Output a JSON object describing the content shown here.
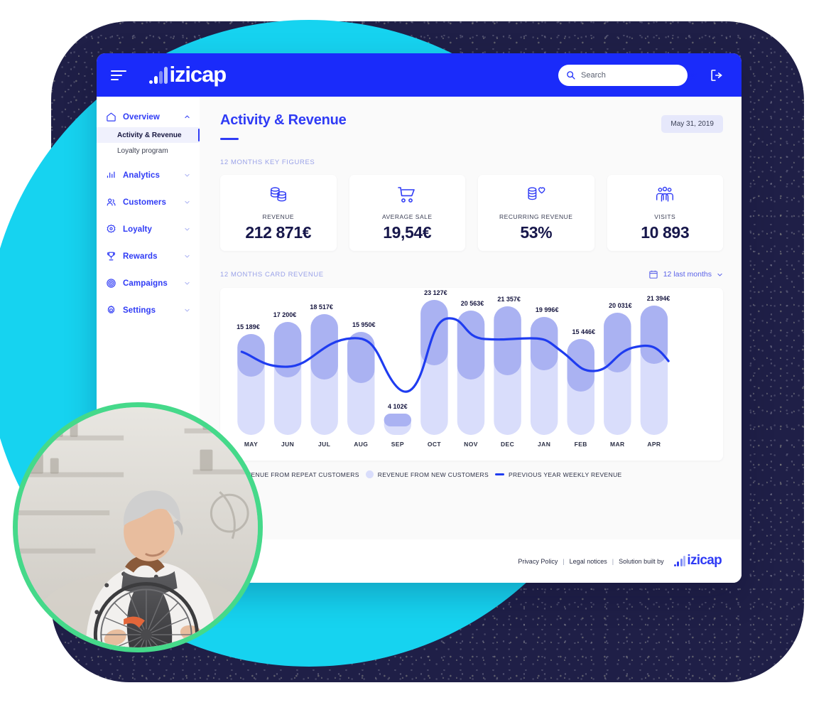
{
  "brand": {
    "name": "izicap",
    "logo_icon": "izicap-logo"
  },
  "header": {
    "menu_icon": "hamburger-menu-icon",
    "search": {
      "placeholder": "Search",
      "value": "",
      "search_icon": "search-icon",
      "clear_icon": "clear-circle-icon"
    },
    "logout_icon": "logout-icon"
  },
  "sidebar": {
    "items": [
      {
        "label": "Overview",
        "icon": "home-icon",
        "chevron": "chevron-up-icon",
        "expanded": true
      },
      {
        "label": "Analytics",
        "icon": "bar-chart-icon",
        "chevron": "chevron-down-icon",
        "expanded": false
      },
      {
        "label": "Customers",
        "icon": "users-icon",
        "chevron": "chevron-down-icon",
        "expanded": false
      },
      {
        "label": "Loyalty",
        "icon": "badge-icon",
        "chevron": "chevron-down-icon",
        "expanded": false
      },
      {
        "label": "Rewards",
        "icon": "trophy-icon",
        "chevron": "chevron-down-icon",
        "expanded": false
      },
      {
        "label": "Campaigns",
        "icon": "target-icon",
        "chevron": "chevron-down-icon",
        "expanded": false
      },
      {
        "label": "Settings",
        "icon": "gear-icon",
        "chevron": "chevron-down-icon",
        "expanded": false
      }
    ],
    "sub_items": [
      {
        "label": "Activity & Revenue",
        "active": true
      },
      {
        "label": "Loyalty program",
        "active": false
      }
    ]
  },
  "page": {
    "title": "Activity & Revenue",
    "date_badge": "May 31, 2019",
    "kpi_section_label": "12 MONTHS KEY FIGURES",
    "chart_section_label": "12 MONTHS CARD REVENUE",
    "range_label": "12 last months",
    "range_icon": "calendar-icon",
    "range_chevron": "chevron-down-icon"
  },
  "kpis": [
    {
      "label": "REVENUE",
      "value": "212 871€",
      "icon": "coins-icon"
    },
    {
      "label": "AVERAGE SALE",
      "value": "19,54€",
      "icon": "shopping-cart-icon"
    },
    {
      "label": "RECURRING REVENUE",
      "value": "53%",
      "icon": "coins-heart-icon"
    },
    {
      "label": "VISITS",
      "value": "10 893",
      "icon": "group-people-icon"
    }
  ],
  "chart_data": {
    "type": "bar",
    "title": "12 MONTHS CARD REVENUE",
    "xlabel": "",
    "ylabel": "",
    "grid": false,
    "legend_position": "bottom",
    "categories": [
      "MAY",
      "JUN",
      "JUL",
      "AUG",
      "SEP",
      "OCT",
      "NOV",
      "DEC",
      "JAN",
      "FEB",
      "MAR",
      "APR"
    ],
    "data_labels": [
      "15 189€",
      "17 200€",
      "18 517€",
      "15 950€",
      "4 102€",
      "23 127€",
      "20 563€",
      "21 357€",
      "19 996€",
      "15 446€",
      "20 031€",
      "21 394€"
    ],
    "values": [
      15189,
      17200,
      18517,
      15950,
      4102,
      23127,
      20563,
      21357,
      19996,
      15446,
      20031,
      21394
    ],
    "ylim": [
      0,
      24000
    ],
    "series": [
      {
        "name": "REVENUE FROM REPEAT CUSTOMERS",
        "color": "#aab2f2",
        "values": [
          5400,
          7100,
          8300,
          6500,
          1500,
          11200,
          9600,
          10000,
          7600,
          5400,
          8200,
          9400
        ]
      },
      {
        "name": "REVENUE FROM NEW CUSTOMERS",
        "color": "#d9ddfb",
        "values": [
          9789,
          10100,
          10217,
          9450,
          2602,
          11927,
          10963,
          11357,
          12396,
          10046,
          11831,
          11994
        ]
      },
      {
        "name": "PREVIOUS YEAR WEEKLY REVENUE",
        "color": "#1f3cf0",
        "type": "line",
        "values": [
          15600,
          14600,
          16800,
          17200,
          10500,
          21600,
          19800,
          19900,
          19600,
          16200,
          19800,
          17600
        ]
      }
    ],
    "legend": [
      {
        "label": "REVENUE FROM REPEAT CUSTOMERS",
        "color": "#aab2f2",
        "marker": "circle"
      },
      {
        "label": "REVENUE FROM NEW CUSTOMERS",
        "color": "#d9ddfb",
        "marker": "circle"
      },
      {
        "label": "PREVIOUS YEAR WEEKLY REVENUE",
        "color": "#1f3cf0",
        "marker": "line"
      }
    ]
  },
  "footer": {
    "privacy": "Privacy Policy",
    "legal": "Legal notices",
    "built_by": "Solution built by",
    "sep": "|",
    "brand": "izicap"
  },
  "colors": {
    "brand_blue": "#1a2bfa",
    "accent_blue": "#2f3bf5",
    "cyan": "#16d3f0",
    "navy": "#1f1f47",
    "green_ring": "#45d98a",
    "bar_dark": "#aab2f2",
    "bar_light": "#d9ddfb"
  }
}
